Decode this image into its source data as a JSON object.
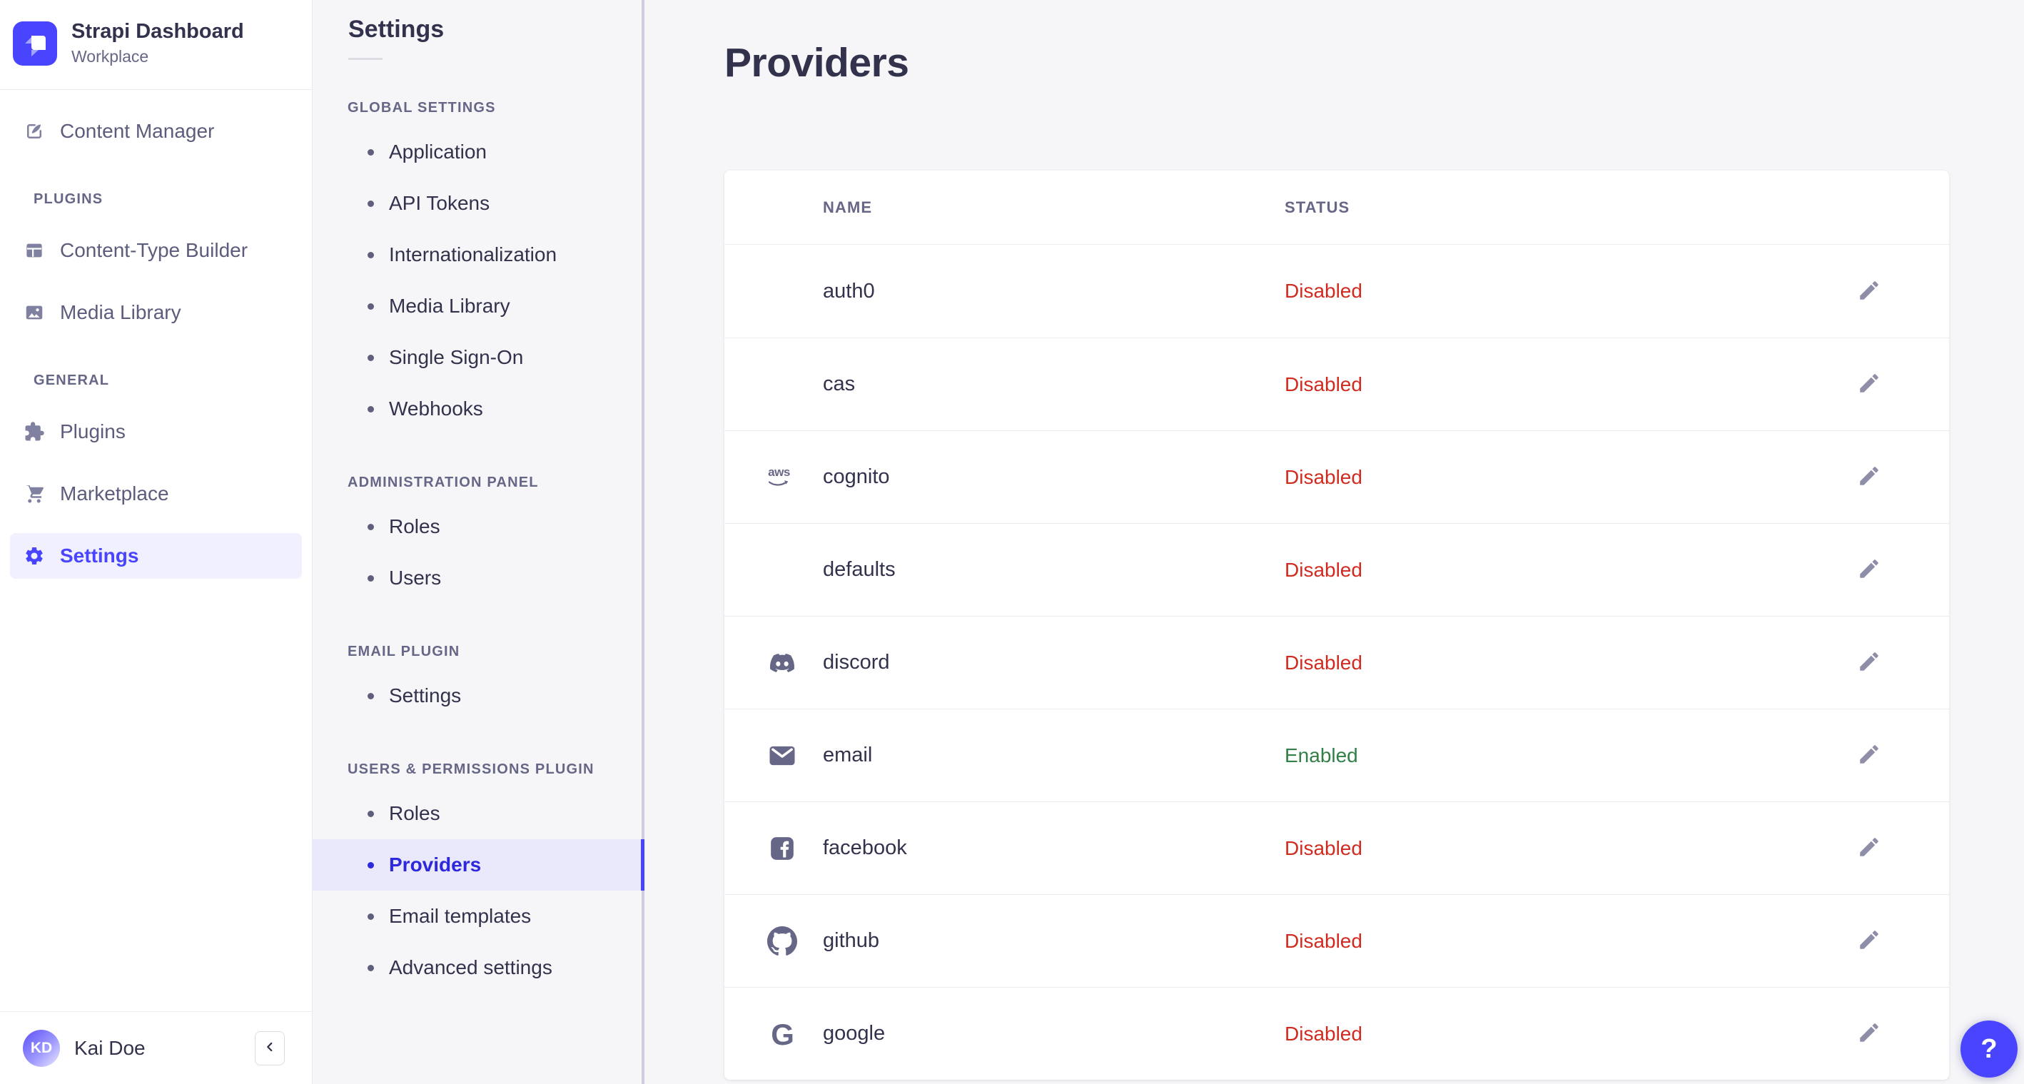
{
  "app": {
    "name": "Strapi Dashboard",
    "workspace": "Workplace"
  },
  "sidebar": {
    "top_items": [
      {
        "label": "Content Manager",
        "icon": "content-manager-icon"
      }
    ],
    "sections": [
      {
        "label": "PLUGINS",
        "items": [
          {
            "label": "Content-Type Builder",
            "icon": "content-type-builder-icon"
          },
          {
            "label": "Media Library",
            "icon": "media-library-icon"
          }
        ]
      },
      {
        "label": "GENERAL",
        "items": [
          {
            "label": "Plugins",
            "icon": "plugins-icon"
          },
          {
            "label": "Marketplace",
            "icon": "marketplace-icon"
          },
          {
            "label": "Settings",
            "icon": "settings-gear-icon",
            "active": true
          }
        ]
      }
    ],
    "user": {
      "initials": "KD",
      "name": "Kai Doe"
    },
    "collapse_label": "‹"
  },
  "subnav": {
    "title": "Settings",
    "sections": [
      {
        "label": "GLOBAL SETTINGS",
        "items": [
          "Application",
          "API Tokens",
          "Internationalization",
          "Media Library",
          "Single Sign-On",
          "Webhooks"
        ]
      },
      {
        "label": "ADMINISTRATION PANEL",
        "items": [
          "Roles",
          "Users"
        ]
      },
      {
        "label": "EMAIL PLUGIN",
        "items": [
          "Settings"
        ]
      },
      {
        "label": "USERS & PERMISSIONS PLUGIN",
        "items": [
          "Roles",
          "Providers",
          "Email templates",
          "Advanced settings"
        ]
      }
    ],
    "active_item": "Providers"
  },
  "content": {
    "title": "Providers",
    "table": {
      "columns": {
        "name": "NAME",
        "status": "STATUS"
      },
      "rows": [
        {
          "name": "auth0",
          "icon": null,
          "status": "Disabled"
        },
        {
          "name": "cas",
          "icon": null,
          "status": "Disabled"
        },
        {
          "name": "cognito",
          "icon": "aws",
          "status": "Disabled"
        },
        {
          "name": "defaults",
          "icon": null,
          "status": "Disabled"
        },
        {
          "name": "discord",
          "icon": "discord",
          "status": "Disabled"
        },
        {
          "name": "email",
          "icon": "email",
          "status": "Enabled"
        },
        {
          "name": "facebook",
          "icon": "facebook",
          "status": "Disabled"
        },
        {
          "name": "github",
          "icon": "github",
          "status": "Disabled"
        },
        {
          "name": "google",
          "icon": "google",
          "status": "Disabled"
        }
      ]
    }
  },
  "help": {
    "label": "?"
  },
  "colors": {
    "primary": "#4945ff",
    "link_active": "#2d27dd",
    "text": "#32324d",
    "text_muted": "#666687",
    "nav_label": "#5c5c7c",
    "danger": "#d02b20",
    "success": "#328048",
    "bg": "#f6f6f9",
    "card": "#ffffff",
    "border": "#eaeaef",
    "border_strong": "#cdcdde",
    "active_bg": "#e9e9fb",
    "settings_active_bg": "#f0f0ff",
    "icon": "#8e8ea9"
  }
}
